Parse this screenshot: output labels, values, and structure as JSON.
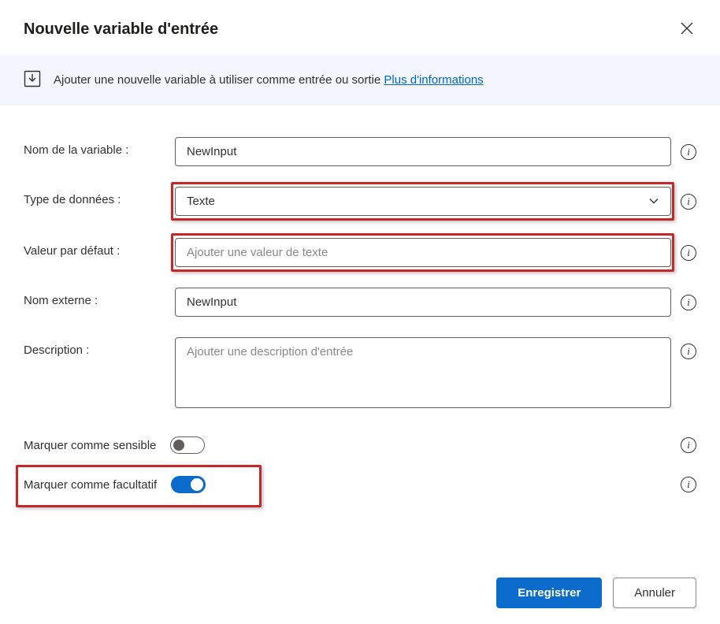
{
  "dialog": {
    "title": "Nouvelle variable d'entrée"
  },
  "banner": {
    "text": "Ajouter une nouvelle variable à utiliser comme entrée ou sortie ",
    "link_text": "Plus d'informations"
  },
  "form": {
    "variable_name": {
      "label": "Nom de la variable :",
      "value": "NewInput"
    },
    "data_type": {
      "label": "Type de données :",
      "value": "Texte"
    },
    "default_value": {
      "label": "Valeur par défaut :",
      "value": "",
      "placeholder": "Ajouter une valeur de texte"
    },
    "external_name": {
      "label": "Nom externe :",
      "value": "NewInput"
    },
    "description": {
      "label": "Description :",
      "value": "",
      "placeholder": "Ajouter une description d'entrée"
    },
    "sensitive": {
      "label": "Marquer comme sensible",
      "value": false
    },
    "optional": {
      "label": "Marquer comme facultatif",
      "value": true
    }
  },
  "footer": {
    "save": "Enregistrer",
    "cancel": "Annuler"
  }
}
